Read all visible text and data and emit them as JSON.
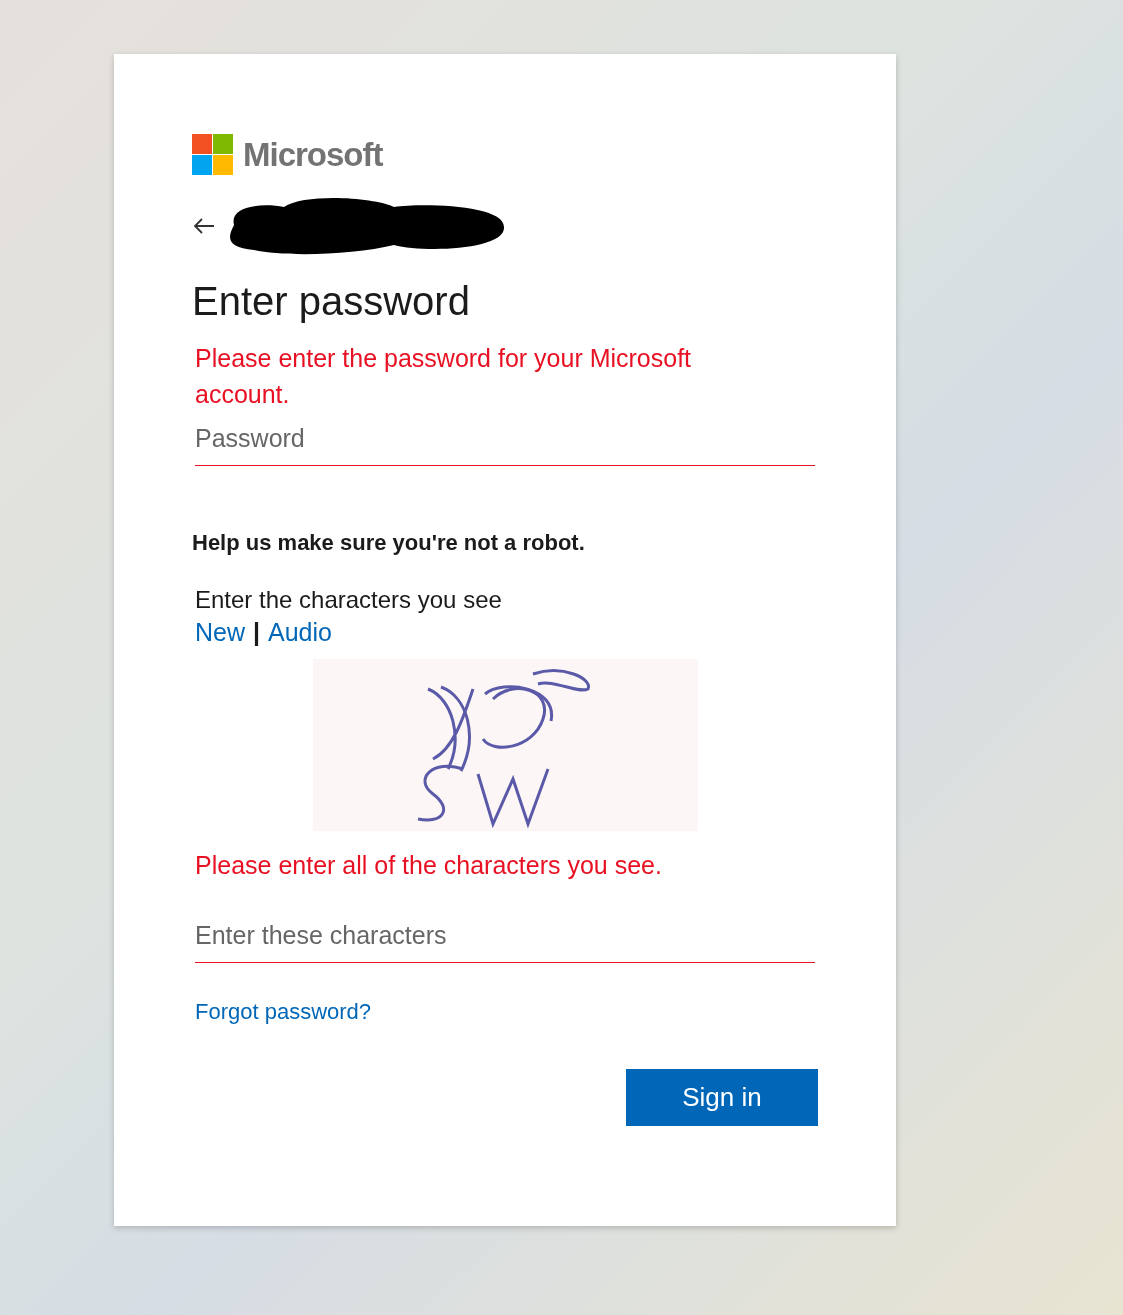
{
  "brand": {
    "name": "Microsoft"
  },
  "identity": {
    "redacted": true
  },
  "title": "Enter password",
  "password_error": "Please enter the password for your Microsoft account.",
  "password_field": {
    "placeholder": "Password",
    "invalid": true
  },
  "robot_heading": "Help us make sure you're not a robot.",
  "captcha": {
    "instruction": "Enter the characters you see",
    "links": [
      {
        "label": "New"
      },
      {
        "label": "Audio"
      }
    ],
    "separator": "|"
  },
  "captcha_error": "Please enter all of the characters you see.",
  "captcha_field": {
    "placeholder": "Enter these characters",
    "invalid": true
  },
  "forgot_link": "Forgot password?",
  "buttons": [
    {
      "label": "Sign in"
    }
  ]
}
